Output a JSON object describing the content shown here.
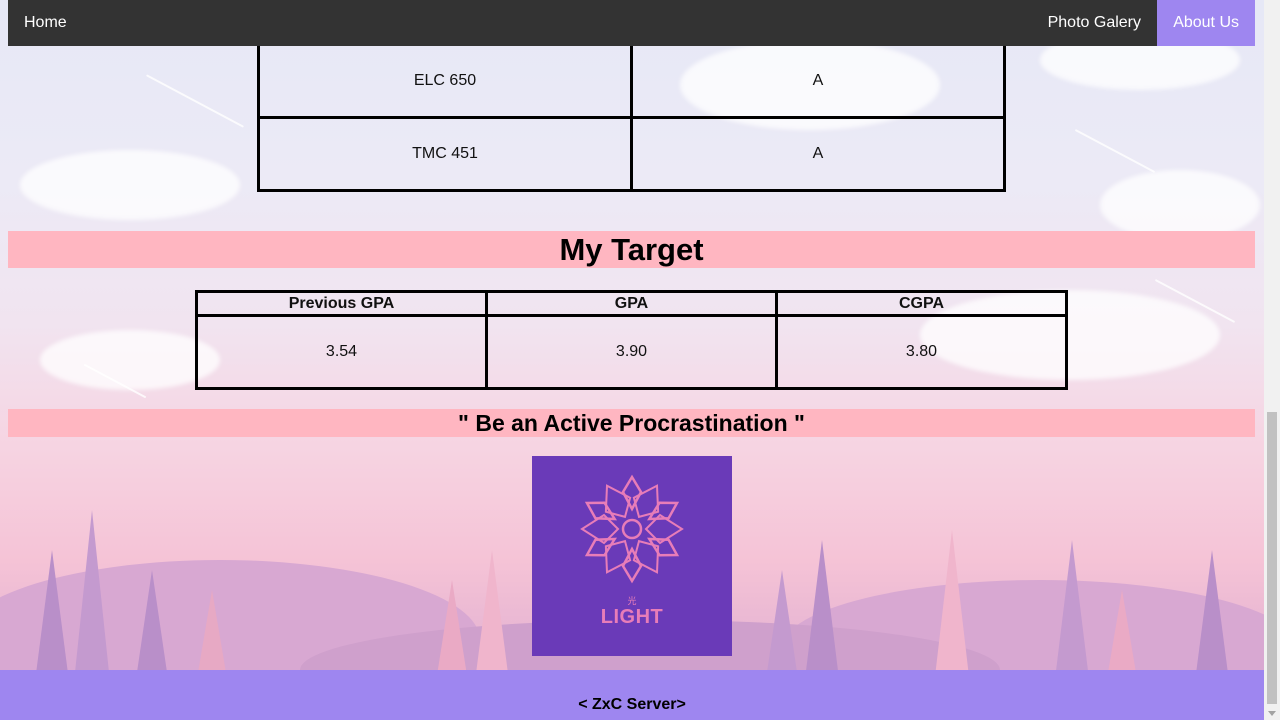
{
  "nav": {
    "home": "Home",
    "photo_gallery": "Photo Galery",
    "about_us": "About Us"
  },
  "grades_table": {
    "rows": [
      {
        "course": "ELC 650",
        "grade": "A"
      },
      {
        "course": "TMC 451",
        "grade": "A"
      }
    ]
  },
  "target": {
    "title": "My Target",
    "headers": [
      "Previous GPA",
      "GPA",
      "CGPA"
    ],
    "values": [
      "3.54",
      "3.90",
      "3.80"
    ]
  },
  "quote": "\" Be an Active Procrastination \"",
  "logo": {
    "text": "LIGHT",
    "kanji": "光",
    "background": "#6a3ab8",
    "accent": "#e87db8"
  },
  "footer": {
    "text": "< ZxC Server>"
  },
  "colors": {
    "navbar": "#333333",
    "active_nav": "#9e86f0",
    "banner": "#ffb6c1",
    "footer": "#9e86f0"
  }
}
